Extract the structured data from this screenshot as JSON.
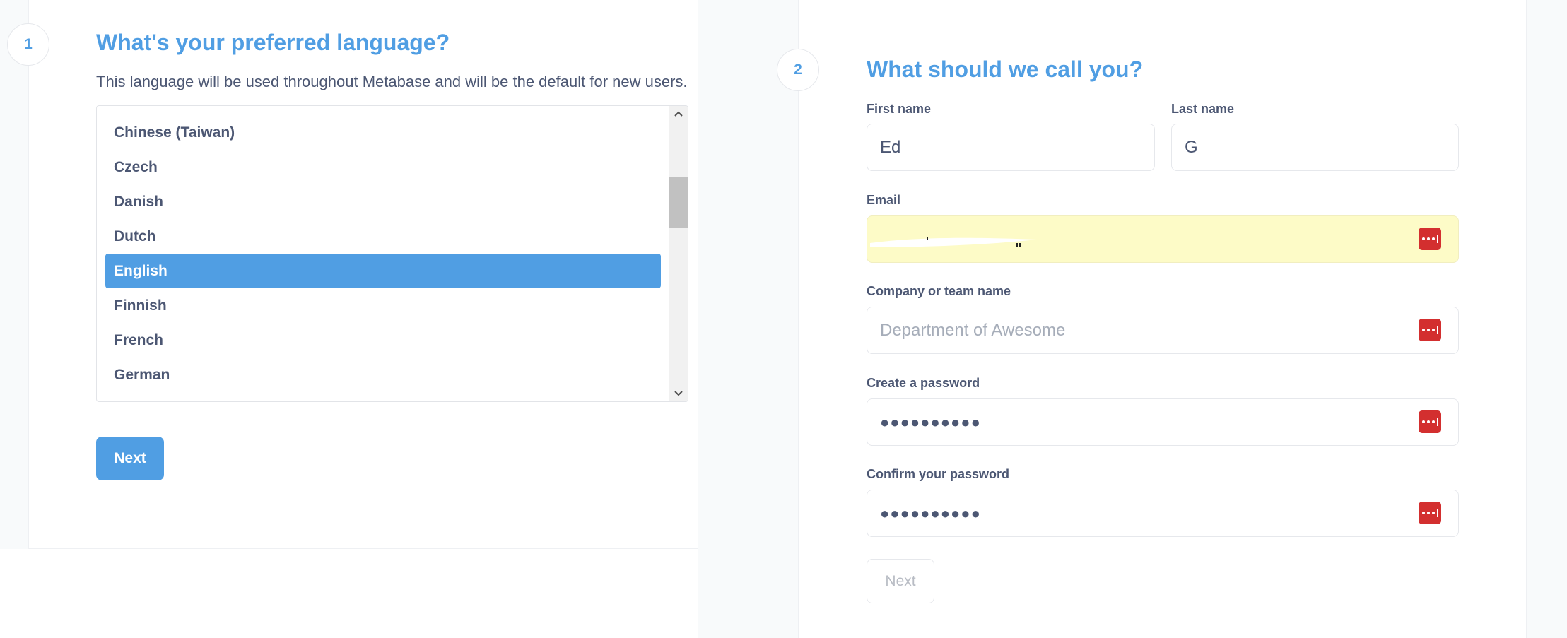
{
  "step1": {
    "number": "1",
    "title": "What's your preferred language?",
    "description": "This language will be used throughout Metabase and will be the default for new users.",
    "languages": [
      "Chinese (Taiwan)",
      "Czech",
      "Danish",
      "Dutch",
      "English",
      "Finnish",
      "French",
      "German"
    ],
    "selected_language": "English",
    "next_label": "Next"
  },
  "step2": {
    "number": "2",
    "title": "What should we call you?",
    "first_name": {
      "label": "First name",
      "value": "Ed"
    },
    "last_name": {
      "label": "Last name",
      "value": "G"
    },
    "email": {
      "label": "Email",
      "value": ""
    },
    "company": {
      "label": "Company or team name",
      "placeholder": "Department of Awesome"
    },
    "password": {
      "label": "Create a password",
      "value": "●●●●●●●●●●"
    },
    "confirm_password": {
      "label": "Confirm your password",
      "value": "●●●●●●●●●●"
    },
    "next_label": "Next"
  },
  "colors": {
    "brand": "#509ee3",
    "text": "#4c5773",
    "autofill_bg": "#fdfbc7",
    "password_manager": "#d32f2f"
  },
  "icons": {
    "scroll_up": "chevron-up-icon",
    "scroll_down": "chevron-down-icon",
    "password_manager": "password-manager-icon"
  }
}
